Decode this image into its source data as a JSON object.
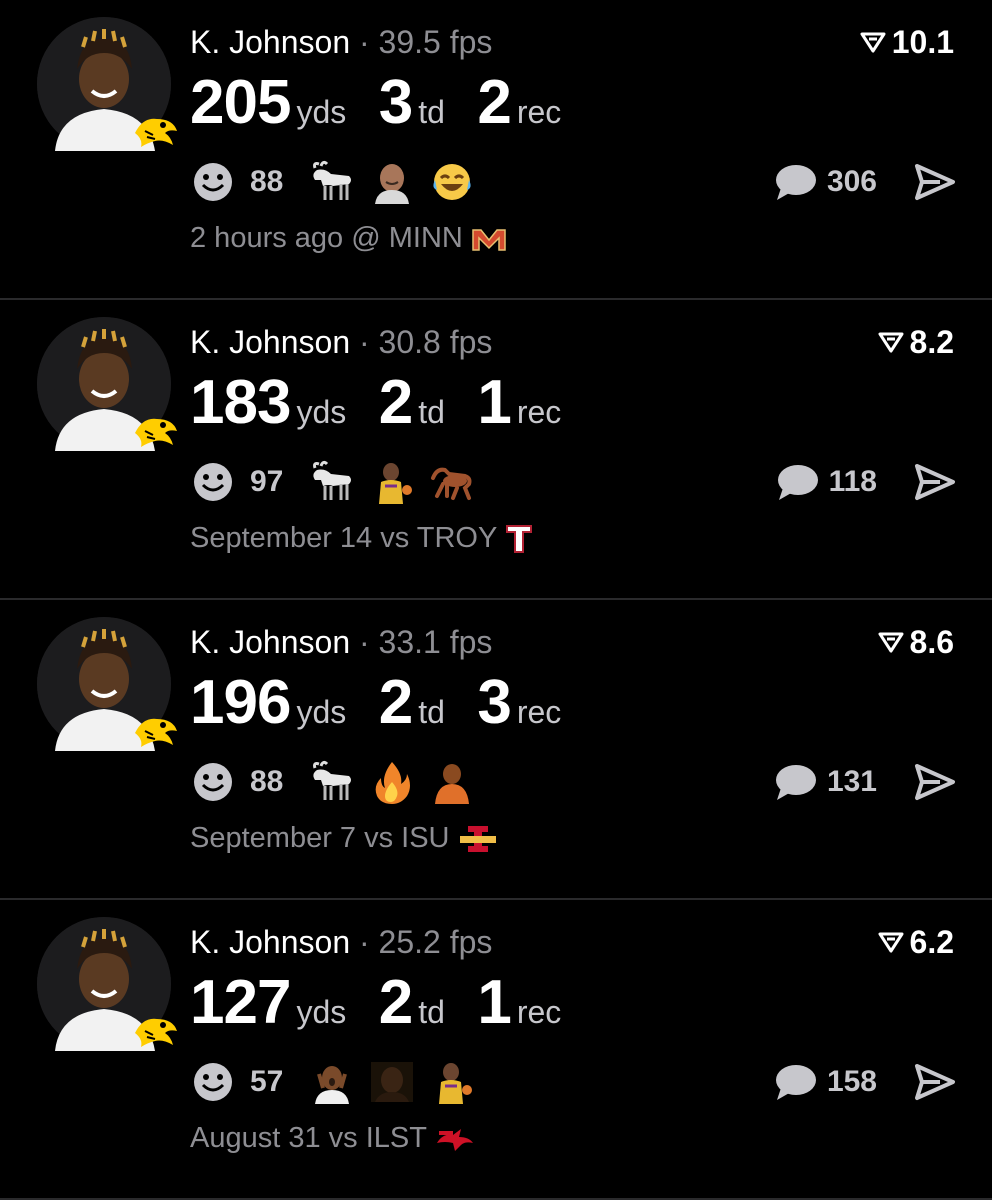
{
  "posts": [
    {
      "name": "K. Johnson",
      "fps": "39.5 fps",
      "score": "10.1",
      "yds": "205",
      "yds_unit": "yds",
      "td": "3",
      "td_unit": "td",
      "rec": "2",
      "rec_unit": "rec",
      "reaction_count": "88",
      "reactions": [
        "smiley-icon",
        "goat-icon",
        "bald-man-emoji",
        "laughing-tears-emoji"
      ],
      "comment_count": "306",
      "meta": "2 hours ago @ MINN",
      "team_logo": "minnesota-logo"
    },
    {
      "name": "K. Johnson",
      "fps": "30.8 fps",
      "score": "8.2",
      "yds": "183",
      "yds_unit": "yds",
      "td": "2",
      "td_unit": "td",
      "rec": "1",
      "rec_unit": "rec",
      "reaction_count": "97",
      "reactions": [
        "smiley-icon",
        "goat-icon",
        "basketball-player-emoji",
        "horse-emoji"
      ],
      "comment_count": "118",
      "meta": "September 14 vs TROY",
      "team_logo": "troy-logo"
    },
    {
      "name": "K. Johnson",
      "fps": "33.1 fps",
      "score": "8.6",
      "yds": "196",
      "yds_unit": "yds",
      "td": "2",
      "td_unit": "td",
      "rec": "3",
      "rec_unit": "rec",
      "reaction_count": "88",
      "reactions": [
        "smiley-icon",
        "goat-icon",
        "fire-emoji",
        "orange-figure-emoji"
      ],
      "comment_count": "131",
      "meta": "September 7 vs ISU",
      "team_logo": "iowa-state-logo"
    },
    {
      "name": "K. Johnson",
      "fps": "25.2 fps",
      "score": "6.2",
      "yds": "127",
      "yds_unit": "yds",
      "td": "2",
      "td_unit": "td",
      "rec": "1",
      "rec_unit": "rec",
      "reaction_count": "57",
      "reactions": [
        "smiley-icon",
        "shocked-man-emoji",
        "dark-portrait-emoji",
        "basketball-player-emoji"
      ],
      "comment_count": "158",
      "meta": "August 31 vs ILST",
      "team_logo": "illinois-state-logo"
    }
  ],
  "colors": {
    "background": "#000000",
    "divider": "#2a2a2c",
    "muted": "#8e8e93",
    "icon_gray": "#c7c7cc",
    "hawkeye_gold": "#FFCD00"
  }
}
